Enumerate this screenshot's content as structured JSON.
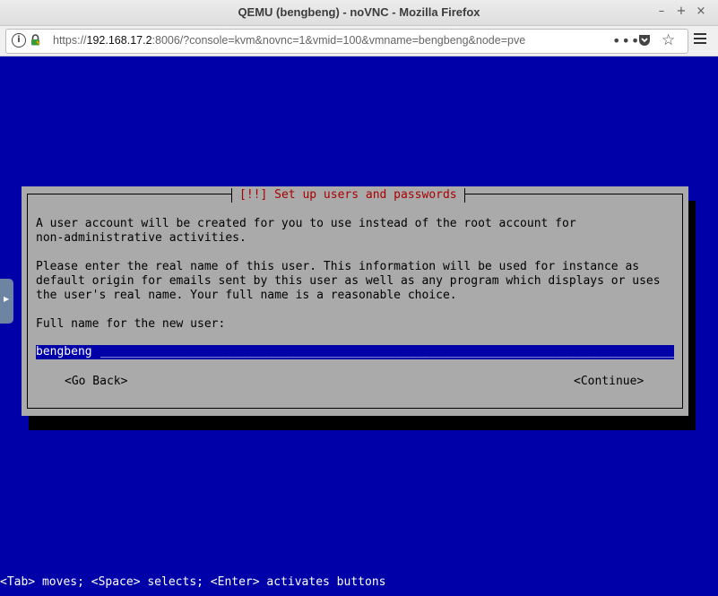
{
  "browser": {
    "window_title": "QEMU (bengbeng) - noVNC - Mozilla Firefox",
    "url_prefix": "https://",
    "url_host": "192.168.17.2",
    "url_rest": ":8006/?console=kvm&novnc=1&vmid=100&vmname=bengbeng&node=pve",
    "controls": {
      "minimize": "–",
      "maximize": "+",
      "close": "×"
    }
  },
  "dialog": {
    "title": "[!!] Set up users and passwords",
    "para1_line1": "A user account will be created for you to use instead of the root account for",
    "para1_line2": "non-administrative activities.",
    "para2_line1": "Please enter the real name of this user. This information will be used for instance as",
    "para2_line2": "default origin for emails sent by this user as well as any program which displays or uses",
    "para2_line3": "the user's real name. Your full name is a reasonable choice.",
    "prompt": "Full name for the new user:",
    "fullname_value": "bengbeng",
    "back_button": "<Go Back>",
    "continue_button": "<Continue>"
  },
  "status_help": "<Tab> moves; <Space> selects; <Enter> activates buttons",
  "icons": [
    "info-icon",
    "lock-icon",
    "more-dots-icon",
    "pocket-icon",
    "bookmark-star-icon",
    "hamburger-menu-icon",
    "vnc-sidebar-handle-icon"
  ],
  "colors": {
    "console_bg": "#0000a8",
    "dialog_bg": "#aaaaaa",
    "title_red": "#a80000"
  }
}
